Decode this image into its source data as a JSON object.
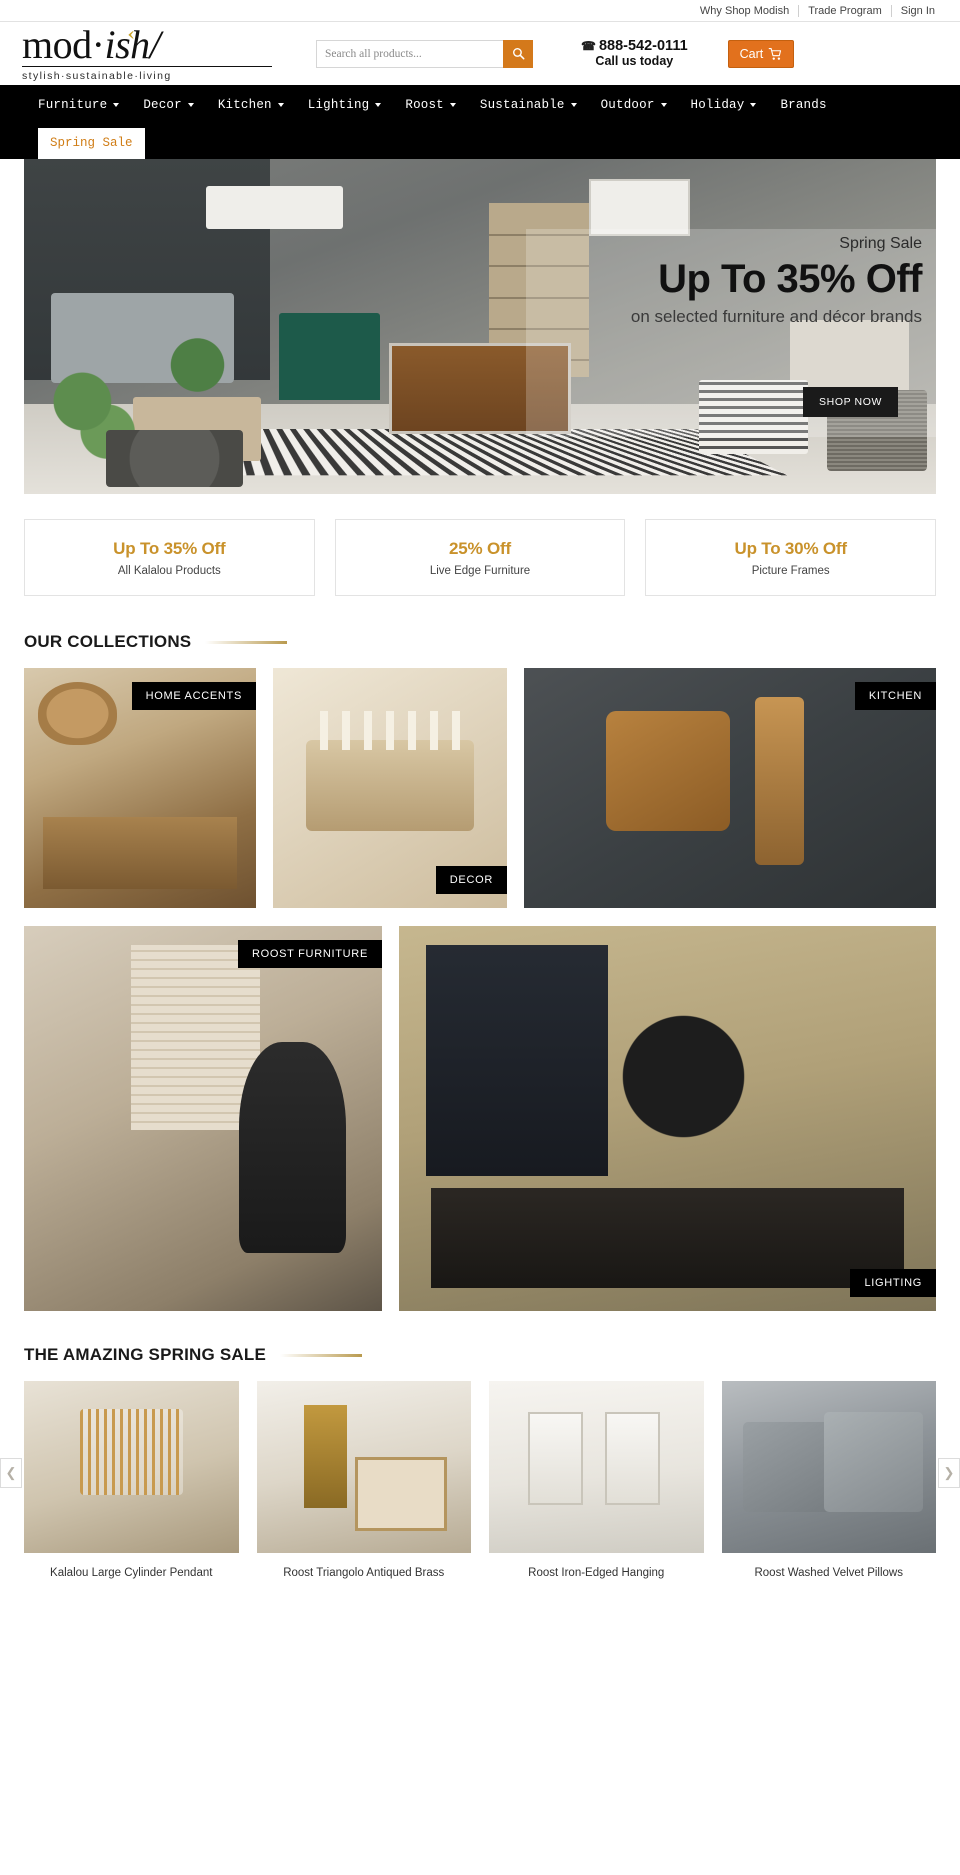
{
  "utility": {
    "links": [
      {
        "label": "Why Shop Modish"
      },
      {
        "label": "Trade Program"
      },
      {
        "label": "Sign In"
      }
    ]
  },
  "brand": {
    "name_main": "mod",
    "name_dot": "·",
    "name_italic": "ish",
    "name_slash": "/",
    "tagline": "stylish·sustainable·living"
  },
  "search": {
    "placeholder": "Search all products...",
    "value": "",
    "icon": "search-icon"
  },
  "contact": {
    "phone": "888-542-0111",
    "phone_icon": "phone-icon",
    "subtitle": "Call us today"
  },
  "cart": {
    "label": "Cart",
    "icon": "cart-icon"
  },
  "nav": {
    "items": [
      {
        "label": "Furniture",
        "has_dropdown": true
      },
      {
        "label": "Decor",
        "has_dropdown": true
      },
      {
        "label": "Kitchen",
        "has_dropdown": true
      },
      {
        "label": "Lighting",
        "has_dropdown": true
      },
      {
        "label": "Roost",
        "has_dropdown": true
      },
      {
        "label": "Sustainable",
        "has_dropdown": true
      },
      {
        "label": "Outdoor",
        "has_dropdown": true
      },
      {
        "label": "Holiday",
        "has_dropdown": true
      },
      {
        "label": "Brands",
        "has_dropdown": false
      }
    ],
    "active_tab": "Spring Sale"
  },
  "hero": {
    "kicker": "Spring Sale",
    "headline": "Up To 35% Off",
    "subline": "on selected furniture and décor brands",
    "button_label": "SHOP NOW"
  },
  "promos": [
    {
      "title": "Up To 35% Off",
      "subtitle": "All Kalalou Products"
    },
    {
      "title": "25% Off",
      "subtitle": "Live Edge Furniture"
    },
    {
      "title": "Up To 30% Off",
      "subtitle": "Picture Frames"
    }
  ],
  "collections": {
    "heading": "OUR COLLECTIONS",
    "tiles": [
      {
        "label": "HOME ACCENTS",
        "label_position": "top-right"
      },
      {
        "label": "DECOR",
        "label_position": "bottom-right"
      },
      {
        "label": "KITCHEN",
        "label_position": "top-right"
      },
      {
        "label": "ROOST FURNITURE",
        "label_position": "top-right"
      },
      {
        "label": "LIGHTING",
        "label_position": "bottom-right"
      }
    ]
  },
  "spring_sale": {
    "heading": "THE AMAZING SPRING SALE",
    "prev_icon": "chevron-left-icon",
    "next_icon": "chevron-right-icon",
    "products": [
      {
        "title": "Kalalou Large Cylinder Pendant"
      },
      {
        "title": "Roost Triangolo Antiqued Brass"
      },
      {
        "title": "Roost Iron-Edged Hanging"
      },
      {
        "title": "Roost Washed Velvet Pillows"
      }
    ]
  },
  "colors": {
    "accent_orange": "#d4791b",
    "cart_orange": "#e2711d",
    "promo_gold": "#c9922b",
    "nav_black": "#000000",
    "tab_text": "#d07d16"
  }
}
